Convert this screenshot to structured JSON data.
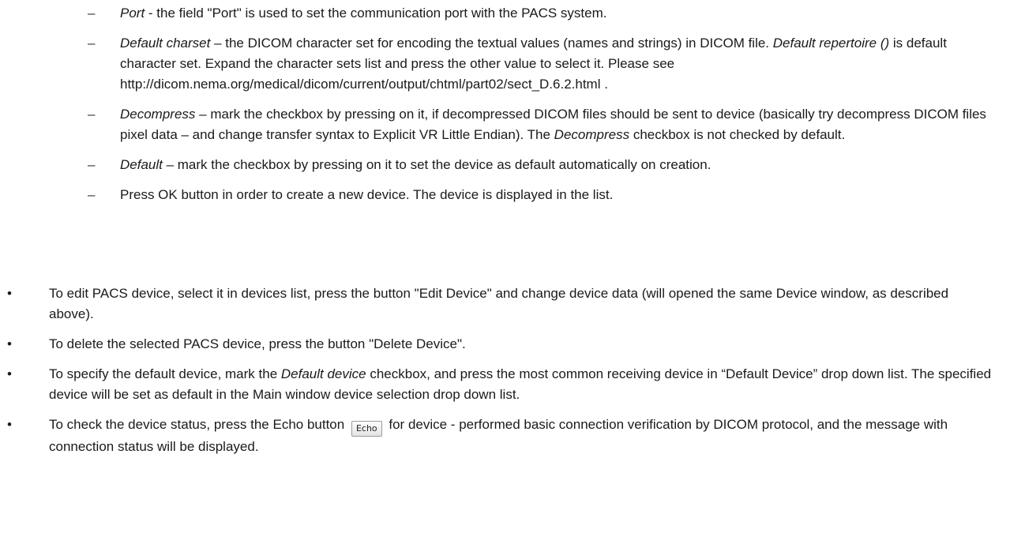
{
  "sub_items": [
    {
      "term": "Port",
      "text": " - the field \"Port\" is used to set the communication port with the PACS system."
    },
    {
      "term": "Default charset",
      "text_a": " – the DICOM character set for encoding the textual values (names and strings) in DICOM file. ",
      "term2": "Default repertoire ()",
      "text_b": " is default character set. Expand the character sets list and press the other value to select it. Please see http://dicom.nema.org/medical/dicom/current/output/chtml/part02/sect_D.6.2.html ."
    },
    {
      "term": "Decompress",
      "text_a": " – mark the checkbox by pressing on it, if decompressed DICOM files should be sent to device (basically try decompress DICOM files pixel data – and change transfer syntax to Explicit VR Little Endian). The ",
      "term2": "Decompress",
      "text_b": " checkbox is not checked by default."
    },
    {
      "term": "Default",
      "text": " – mark the checkbox by pressing on it to set the device as default automatically on creation."
    },
    {
      "text": "Press OK button in order to create a new device. The device is displayed in the list."
    }
  ],
  "sub_dash": "–",
  "main_bullet": "•",
  "main_items": [
    {
      "text": "To edit PACS device, select it in devices list, press the button \"Edit Device\" and change device data (will opened  the same Device window, as described above)."
    },
    {
      "text": "To delete the selected PACS device, press the button \"Delete Device\"."
    },
    {
      "text_a": "To specify the default device, mark the ",
      "term": "Default device",
      "text_b": " checkbox, and press the most common receiving device in “Default Device” drop down list. The specified device will be set as default in the Main window device selection drop down list."
    },
    {
      "text_a": "To check the device status, press the Echo button ",
      "button_label": "Echo",
      "text_b": " for device - performed basic connection verification by DICOM protocol, and the message with connection status will be displayed."
    }
  ]
}
